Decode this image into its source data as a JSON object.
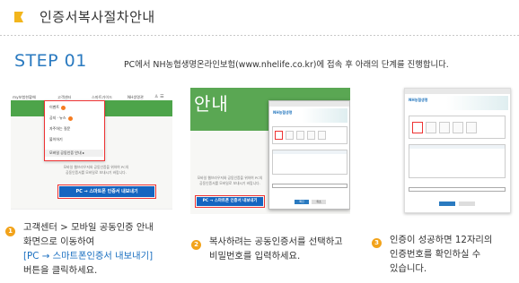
{
  "header": {
    "title": "인증서복사절차안내"
  },
  "step": {
    "label": "STEP 01",
    "description": "PC에서 NH농협생명온라인보험(www.nhelife.co.kr)에 접속 후 아래의 단계를 진행합니다."
  },
  "screenshot1": {
    "nav": [
      "my보험현황해",
      "고객센터",
      "스마트가이드",
      "NH생명관"
    ],
    "dropdown": [
      "이벤트",
      "공지 · 뉴스",
      "자주하는 질문",
      "불이하기",
      "모바일 공동인증 안내"
    ],
    "faded_lines": [
      "모바일 웹브라우저와 공동인증을 위하여 PC의",
      "공동인증서를 모바일로 보내시기 바랍니다."
    ],
    "cta": "PC → 스마트폰 인증서 내보내기"
  },
  "screenshot2": {
    "big_text": "안내",
    "faded_lines": [
      "모바일 웹브라우저와 공동인증을 위하여 PC의",
      "공동인증서를 모바일로 보내시기 바랍니다."
    ],
    "cta": "PC → 스마트폰 인증서 내보내기",
    "dialog_logo": "NH농협생명",
    "ok": "확인",
    "cancel": "취소"
  },
  "screenshot3": {
    "dialog_logo": "NH농협생명"
  },
  "instructions": [
    {
      "num": "1",
      "line1": "고객센터 > 모바일 공동인증 안내",
      "line2": "화면으로 이동하여",
      "line3": "[PC → 스마트폰인증서 내보내기]",
      "line4": "버튼을 클릭하세요."
    },
    {
      "num": "2",
      "line1": "복사하려는 공동인증서를 선택하고",
      "line2": "비밀번호를 입력하세요."
    },
    {
      "num": "3",
      "line1": "인증이 성공하면 12자리의",
      "line2": "인증번호를 확인하실 수",
      "line3": "있습니다."
    }
  ],
  "colors": {
    "accent_orange": "#f2a31b",
    "step_blue": "#2a7ac0",
    "link_blue": "#1a6fc0",
    "nh_green": "#5aa753",
    "highlight_red": "#e33333"
  }
}
